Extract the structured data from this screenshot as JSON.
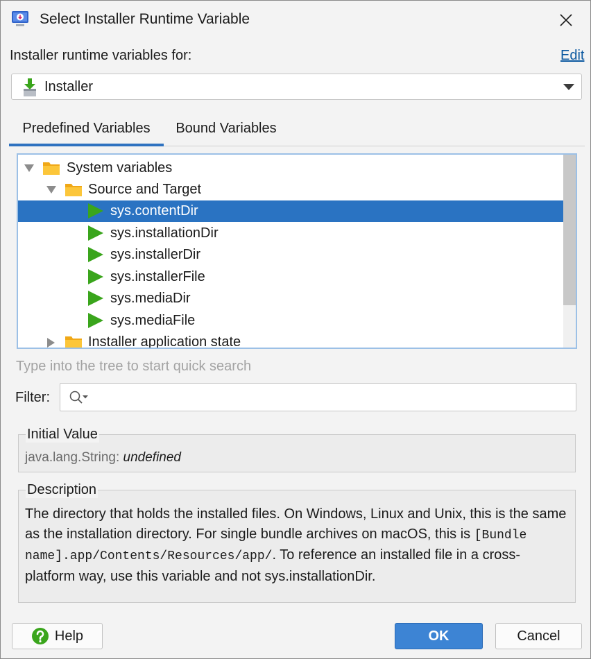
{
  "window": {
    "title": "Select Installer Runtime Variable"
  },
  "header": {
    "label": "Installer runtime variables for:",
    "edit_link": "Edit"
  },
  "combo": {
    "value": "Installer"
  },
  "tabs": [
    {
      "label": "Predefined Variables",
      "active": true
    },
    {
      "label": "Bound Variables",
      "active": false
    }
  ],
  "tree": {
    "rows": [
      {
        "label": "System variables",
        "type": "folder",
        "expanded": true,
        "level": 0
      },
      {
        "label": "Source and Target",
        "type": "folder",
        "expanded": true,
        "level": 1
      },
      {
        "label": "sys.contentDir",
        "type": "variable",
        "selected": true,
        "level": 2
      },
      {
        "label": "sys.installationDir",
        "type": "variable",
        "level": 2
      },
      {
        "label": "sys.installerDir",
        "type": "variable",
        "level": 2
      },
      {
        "label": "sys.installerFile",
        "type": "variable",
        "level": 2
      },
      {
        "label": "sys.mediaDir",
        "type": "variable",
        "level": 2
      },
      {
        "label": "sys.mediaFile",
        "type": "variable",
        "level": 2
      },
      {
        "label": "Installer application state",
        "type": "folder",
        "expanded": false,
        "level": 1
      }
    ]
  },
  "quick_search_hint": "Type into the tree to start quick search",
  "filter": {
    "label": "Filter:",
    "value": ""
  },
  "initial_value": {
    "title": "Initial Value",
    "type_text": "java.lang.String:",
    "value_text": "undefined"
  },
  "description": {
    "title": "Description",
    "text_1": "The directory that holds the installed files. On Windows, Linux and Unix, this is the same as the installation directory. For single bundle archives on macOS, this is ",
    "code": "[Bundle name].app/Contents/Resources/app/",
    "text_2": ". To reference an installed file in a cross-platform way, use this variable and not sys.installationDir."
  },
  "buttons": {
    "help": "Help",
    "ok": "OK",
    "cancel": "Cancel"
  },
  "colors": {
    "selection": "#2a73c2",
    "ok_button": "#3d84d4",
    "variable_icon": "#3aa51c",
    "folder_icon": "#f5b81c",
    "link": "#0a58a0"
  },
  "icons": {
    "app": "installer-download-icon",
    "close": "close-icon",
    "folder": "folder-icon",
    "variable": "variable-triangle-icon",
    "search": "search-icon",
    "help": "help-question-icon"
  }
}
